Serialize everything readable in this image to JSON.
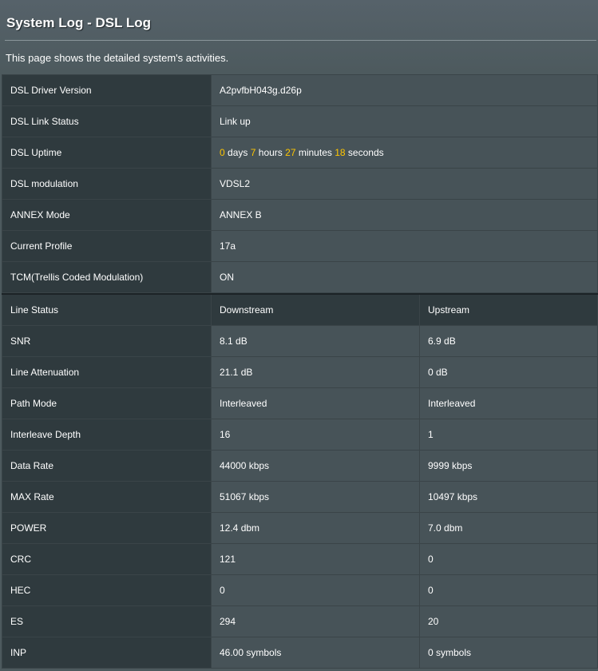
{
  "page": {
    "title": "System Log - DSL Log",
    "description": "This page shows the detailed system's activities."
  },
  "info_rows": [
    {
      "label": "DSL Driver Version",
      "value": "A2pvfbH043g.d26p"
    },
    {
      "label": "DSL Link Status",
      "value": "Link up"
    },
    {
      "label": "DSL Uptime"
    },
    {
      "label": "DSL modulation",
      "value": "VDSL2"
    },
    {
      "label": "ANNEX Mode",
      "value": "ANNEX B"
    },
    {
      "label": "Current Profile",
      "value": "17a"
    },
    {
      "label": "TCM(Trellis Coded Modulation)",
      "value": "ON"
    }
  ],
  "uptime": {
    "days": "0",
    "days_unit": "days",
    "hours": "7",
    "hours_unit": "hours",
    "minutes": "27",
    "minutes_unit": "minutes",
    "seconds": "18",
    "seconds_unit": "seconds"
  },
  "stats_header": {
    "label": "Line Status",
    "downstream": "Downstream",
    "upstream": "Upstream"
  },
  "stats_rows": [
    {
      "label": "SNR",
      "downstream": "8.1 dB",
      "upstream": "6.9 dB"
    },
    {
      "label": "Line Attenuation",
      "downstream": "21.1 dB",
      "upstream": "0 dB"
    },
    {
      "label": "Path Mode",
      "downstream": "Interleaved",
      "upstream": "Interleaved"
    },
    {
      "label": "Interleave Depth",
      "downstream": "16",
      "upstream": "1"
    },
    {
      "label": "Data Rate",
      "downstream": "44000 kbps",
      "upstream": "9999 kbps"
    },
    {
      "label": "MAX Rate",
      "downstream": "51067 kbps",
      "upstream": "10497 kbps"
    },
    {
      "label": "POWER",
      "downstream": "12.4 dbm",
      "upstream": "7.0 dbm"
    },
    {
      "label": "CRC",
      "downstream": "121",
      "upstream": "0"
    },
    {
      "label": "HEC",
      "downstream": "0",
      "upstream": "0"
    },
    {
      "label": "ES",
      "downstream": "294",
      "upstream": "20"
    },
    {
      "label": "INP",
      "downstream": "46.00 symbols",
      "upstream": "0 symbols"
    }
  ],
  "colors": {
    "background": "#4d5a5e",
    "label_cell": "#2f3a3e",
    "value_cell": "#475358",
    "highlight": "#ffc600"
  }
}
